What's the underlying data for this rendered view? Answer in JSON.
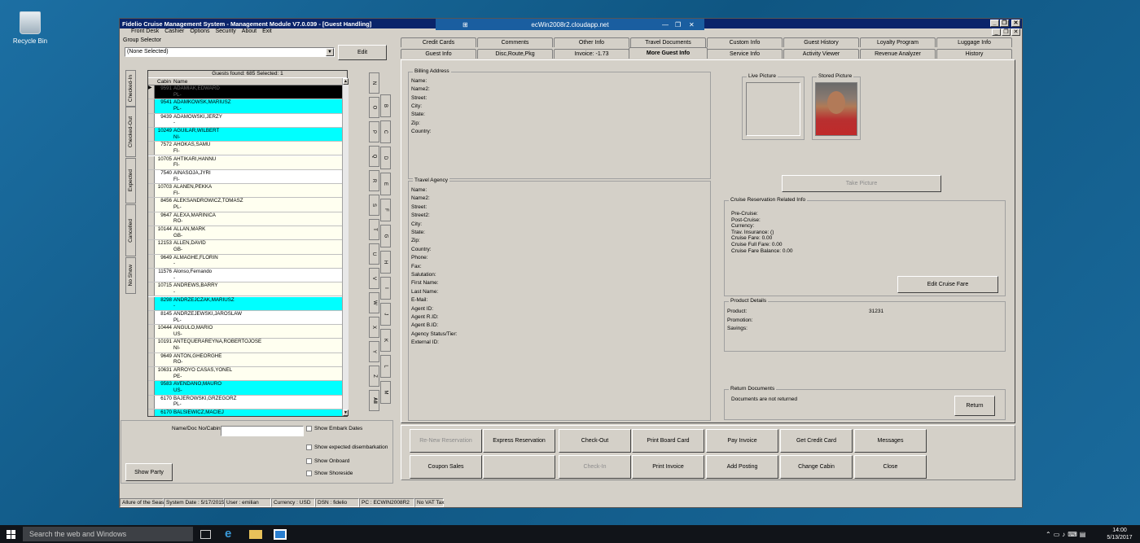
{
  "desktop": {
    "recycle_bin": "Recycle Bin"
  },
  "rdp": {
    "title": "ecWin2008r2.cloudapp.net",
    "pin": "⊞",
    "min": "—",
    "max": "❐",
    "close": "✕"
  },
  "window": {
    "title": "Fidelio Cruise Management System - Management Module V7.0.039 - [Guest Handling]",
    "min": "_",
    "max": "❐",
    "close": "✕",
    "mdi_min": "_",
    "mdi_max": "❐",
    "mdi_close": "✕"
  },
  "menu": [
    "Front Desk",
    "Cashier",
    "Options",
    "Security",
    "About",
    "Exit"
  ],
  "group_selector": {
    "label": "Group Selector",
    "value": "(None Selected)",
    "edit": "Edit"
  },
  "guests": {
    "found_text": "Guests found: 685 Selected: 1",
    "col_cabin": "Cabin",
    "col_name": "Name",
    "rows": [
      {
        "cabin": "9591",
        "name": "ADAMIAK,EDWARD",
        "nat": "PL-",
        "style": "sel"
      },
      {
        "cabin": "9541",
        "name": "ADAMKOWSK,MARIUSZ",
        "nat": "PL-",
        "style": "cyan"
      },
      {
        "cabin": "9439",
        "name": "ADAMOWSKI,JERZY",
        "nat": "-",
        "style": "white"
      },
      {
        "cabin": "10249",
        "name": "AGUILAR,WILBERT",
        "nat": "NI-",
        "style": "cyan"
      },
      {
        "cabin": "7572",
        "name": "AHOKAS,SAMU",
        "nat": "FI-",
        "style": "cream"
      },
      {
        "cabin": "10705",
        "name": "AHTIKARI,HANNU",
        "nat": "FI-",
        "style": "cream"
      },
      {
        "cabin": "7540",
        "name": "AINASOJA,JYRI",
        "nat": "FI-",
        "style": "white"
      },
      {
        "cabin": "10703",
        "name": "ALANEN,PEKKA",
        "nat": "FI-",
        "style": "cream"
      },
      {
        "cabin": "8456",
        "name": "ALEKSANDROWICZ,TOMASZ",
        "nat": "PL-",
        "style": "cream"
      },
      {
        "cabin": "9647",
        "name": "ALEXA,MARINICA",
        "nat": "RO-",
        "style": "cream"
      },
      {
        "cabin": "10144",
        "name": "ALLAN,MARK",
        "nat": "GB-",
        "style": "cream"
      },
      {
        "cabin": "12153",
        "name": "ALLEN,DAVID",
        "nat": "GB-",
        "style": "cream"
      },
      {
        "cabin": "9649",
        "name": "ALMAGHE,FLORIN",
        "nat": "-",
        "style": "cream"
      },
      {
        "cabin": "11576",
        "name": "Alonso,Fernando",
        "nat": "-",
        "style": "white"
      },
      {
        "cabin": "10715",
        "name": "ANDREWS,BARRY",
        "nat": "-",
        "style": "cream"
      },
      {
        "cabin": "8298",
        "name": "ANDRZEJCZAK,MARIUSZ",
        "nat": "-",
        "style": "cyan"
      },
      {
        "cabin": "8145",
        "name": "ANDRZEJEWSKI,JAROSLAW",
        "nat": "PL-",
        "style": "white"
      },
      {
        "cabin": "10444",
        "name": "ANGULO,MARIO",
        "nat": "US-",
        "style": "cream"
      },
      {
        "cabin": "10191",
        "name": "ANTEQUERAREYNA,ROBERTOJOSE",
        "nat": "NI-",
        "style": "cream"
      },
      {
        "cabin": "9649",
        "name": "ANTON,GHEORGHE",
        "nat": "RO-",
        "style": "cream"
      },
      {
        "cabin": "10631",
        "name": "ARROYO CASAS,YONEL",
        "nat": "PE-",
        "style": "cream"
      },
      {
        "cabin": "9583",
        "name": "AVENDANO,MAURO",
        "nat": "US-",
        "style": "cyan"
      },
      {
        "cabin": "6170",
        "name": "BAJEROWSKI,GRZEGORZ",
        "nat": "PL-",
        "style": "white"
      },
      {
        "cabin": "6170",
        "name": "BALSIEWICZ,MACIEJ",
        "nat": "",
        "style": "cyan"
      }
    ]
  },
  "status_tabs": [
    "Checked-In",
    "Checked-Out",
    "Expected",
    "Cancelled",
    "No Show"
  ],
  "letters": [
    "N",
    "O",
    "P",
    "Q",
    "R",
    "S",
    "T",
    "U",
    "V",
    "W",
    "X",
    "Y",
    "Z",
    "All"
  ],
  "letters2": [
    "B",
    "C",
    "D",
    "E",
    "F",
    "G",
    "H",
    "I",
    "J",
    "K",
    "L",
    "M"
  ],
  "search": {
    "label": "Name/Doc No/Cabin",
    "value": "",
    "show_party": "Show Party",
    "checks": [
      "Show Embark Dates",
      "Show expected disembarkation",
      "Show Onboard",
      "Show Shoreside"
    ]
  },
  "tabs_row1": [
    "Credit Cards",
    "Comments",
    "Other Info",
    "Travel Documents",
    "Custom Info",
    "Guest History",
    "Loyalty Program",
    "Luggage Info"
  ],
  "tabs_row2": [
    "Guest Info",
    "Disc,Route,Pkg",
    "Invoice: -1.73",
    "More Guest Info",
    "Service Info",
    "Activity Viewer",
    "Revenue Analyzer",
    "History"
  ],
  "billing": {
    "label": "Billing Address",
    "fields": [
      "Name:",
      "Name2:",
      "Street:",
      "City:",
      "State:",
      "Zip:",
      "Country:"
    ]
  },
  "agency": {
    "label": "Travel Agency",
    "fields": [
      "Name:",
      "Name2:",
      "Street:",
      "Street2:",
      "City:",
      "State:",
      "Zip:",
      "Country:",
      "Phone:",
      "Fax:",
      "Salutation:",
      "First Name:",
      "Last Name:",
      "E-Mail:",
      "Agent ID:",
      "Agent R.ID:",
      "Agent B.ID:",
      "Agency Status/Tier:",
      "External ID:"
    ]
  },
  "pictures": {
    "live": "Live Picture",
    "stored": "Stored Picture",
    "take": "Take Picture"
  },
  "cruise": {
    "label": "Cruise Reservation Related Info",
    "lines": [
      "Pre-Cruise:",
      "Post-Cruise:",
      "Currency:",
      "Trav. Insurance:  ()",
      "Cruise Fare: 0.00",
      "Cruise Full Fare: 0.00",
      "Cruise Fare Balance: 0.00"
    ],
    "edit": "Edit Cruise Fare"
  },
  "product": {
    "label": "Product Details",
    "product_label": "Product:",
    "product_value": "31231",
    "promotion": "Promotion:",
    "savings": "Savings:"
  },
  "return_docs": {
    "label": "Return Documents",
    "text": "Documents are not returned",
    "button": "Return"
  },
  "actions_row1": [
    {
      "label": "Re-New Reservation",
      "enabled": false
    },
    {
      "label": "Express Reservation",
      "enabled": true
    },
    {
      "label": "Check-Out",
      "enabled": true
    },
    {
      "label": "Print Board Card",
      "enabled": true
    },
    {
      "label": "Pay Invoice",
      "enabled": true
    },
    {
      "label": "Get Credit Card",
      "enabled": true
    },
    {
      "label": "Messages",
      "enabled": true
    }
  ],
  "actions_row2": [
    {
      "label": "Coupon Sales",
      "enabled": true
    },
    {
      "label": "",
      "enabled": true
    },
    {
      "label": "Check-In",
      "enabled": false
    },
    {
      "label": "Print Invoice",
      "enabled": true
    },
    {
      "label": "Add Posting",
      "enabled": true
    },
    {
      "label": "Change Cabin",
      "enabled": true
    },
    {
      "label": "Close",
      "enabled": true
    }
  ],
  "status": [
    "Allure of the Seas",
    "System Date : 5/17/2015",
    "User : emilian",
    "Currency : USD",
    "DSN : fidelio",
    "PC : ECWIN2008R2",
    "No VAT Tax"
  ],
  "taskbar": {
    "search": "Search the web and Windows",
    "time": "14:00",
    "date": "5/13/2017"
  },
  "colors": {
    "cyan": "#00ffff",
    "cream": "#fffff0",
    "selected": "#000000",
    "title": "#0a246a"
  }
}
